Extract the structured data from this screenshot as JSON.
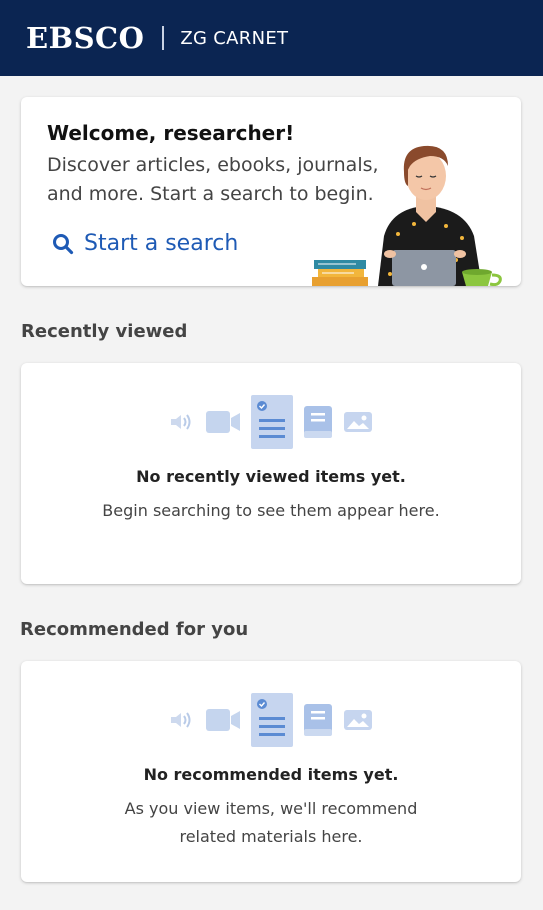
{
  "header": {
    "logo_text": "EBSCO",
    "institution_name": "ZG CARNET",
    "background_color": "#0b2552"
  },
  "welcome": {
    "title": "Welcome, researcher!",
    "body": "Discover articles, ebooks, journals, and more. Start a search to begin.",
    "start_search_label": "Start a search",
    "accent_color": "#1e5ab5",
    "illustration_icon": "researcher-with-laptop-illustration"
  },
  "recently_viewed": {
    "section_title": "Recently viewed",
    "empty_title": "No recently viewed items yet.",
    "empty_body": "Begin searching to see them appear here.",
    "icons": [
      "audio-icon",
      "video-icon",
      "article-icon",
      "book-icon",
      "image-icon"
    ]
  },
  "recommended": {
    "section_title": "Recommended for you",
    "empty_title": "No recommended items yet.",
    "empty_body": "As you view items, we'll recommend related materials here.",
    "icons": [
      "audio-icon",
      "video-icon",
      "article-icon",
      "book-icon",
      "image-icon"
    ]
  }
}
